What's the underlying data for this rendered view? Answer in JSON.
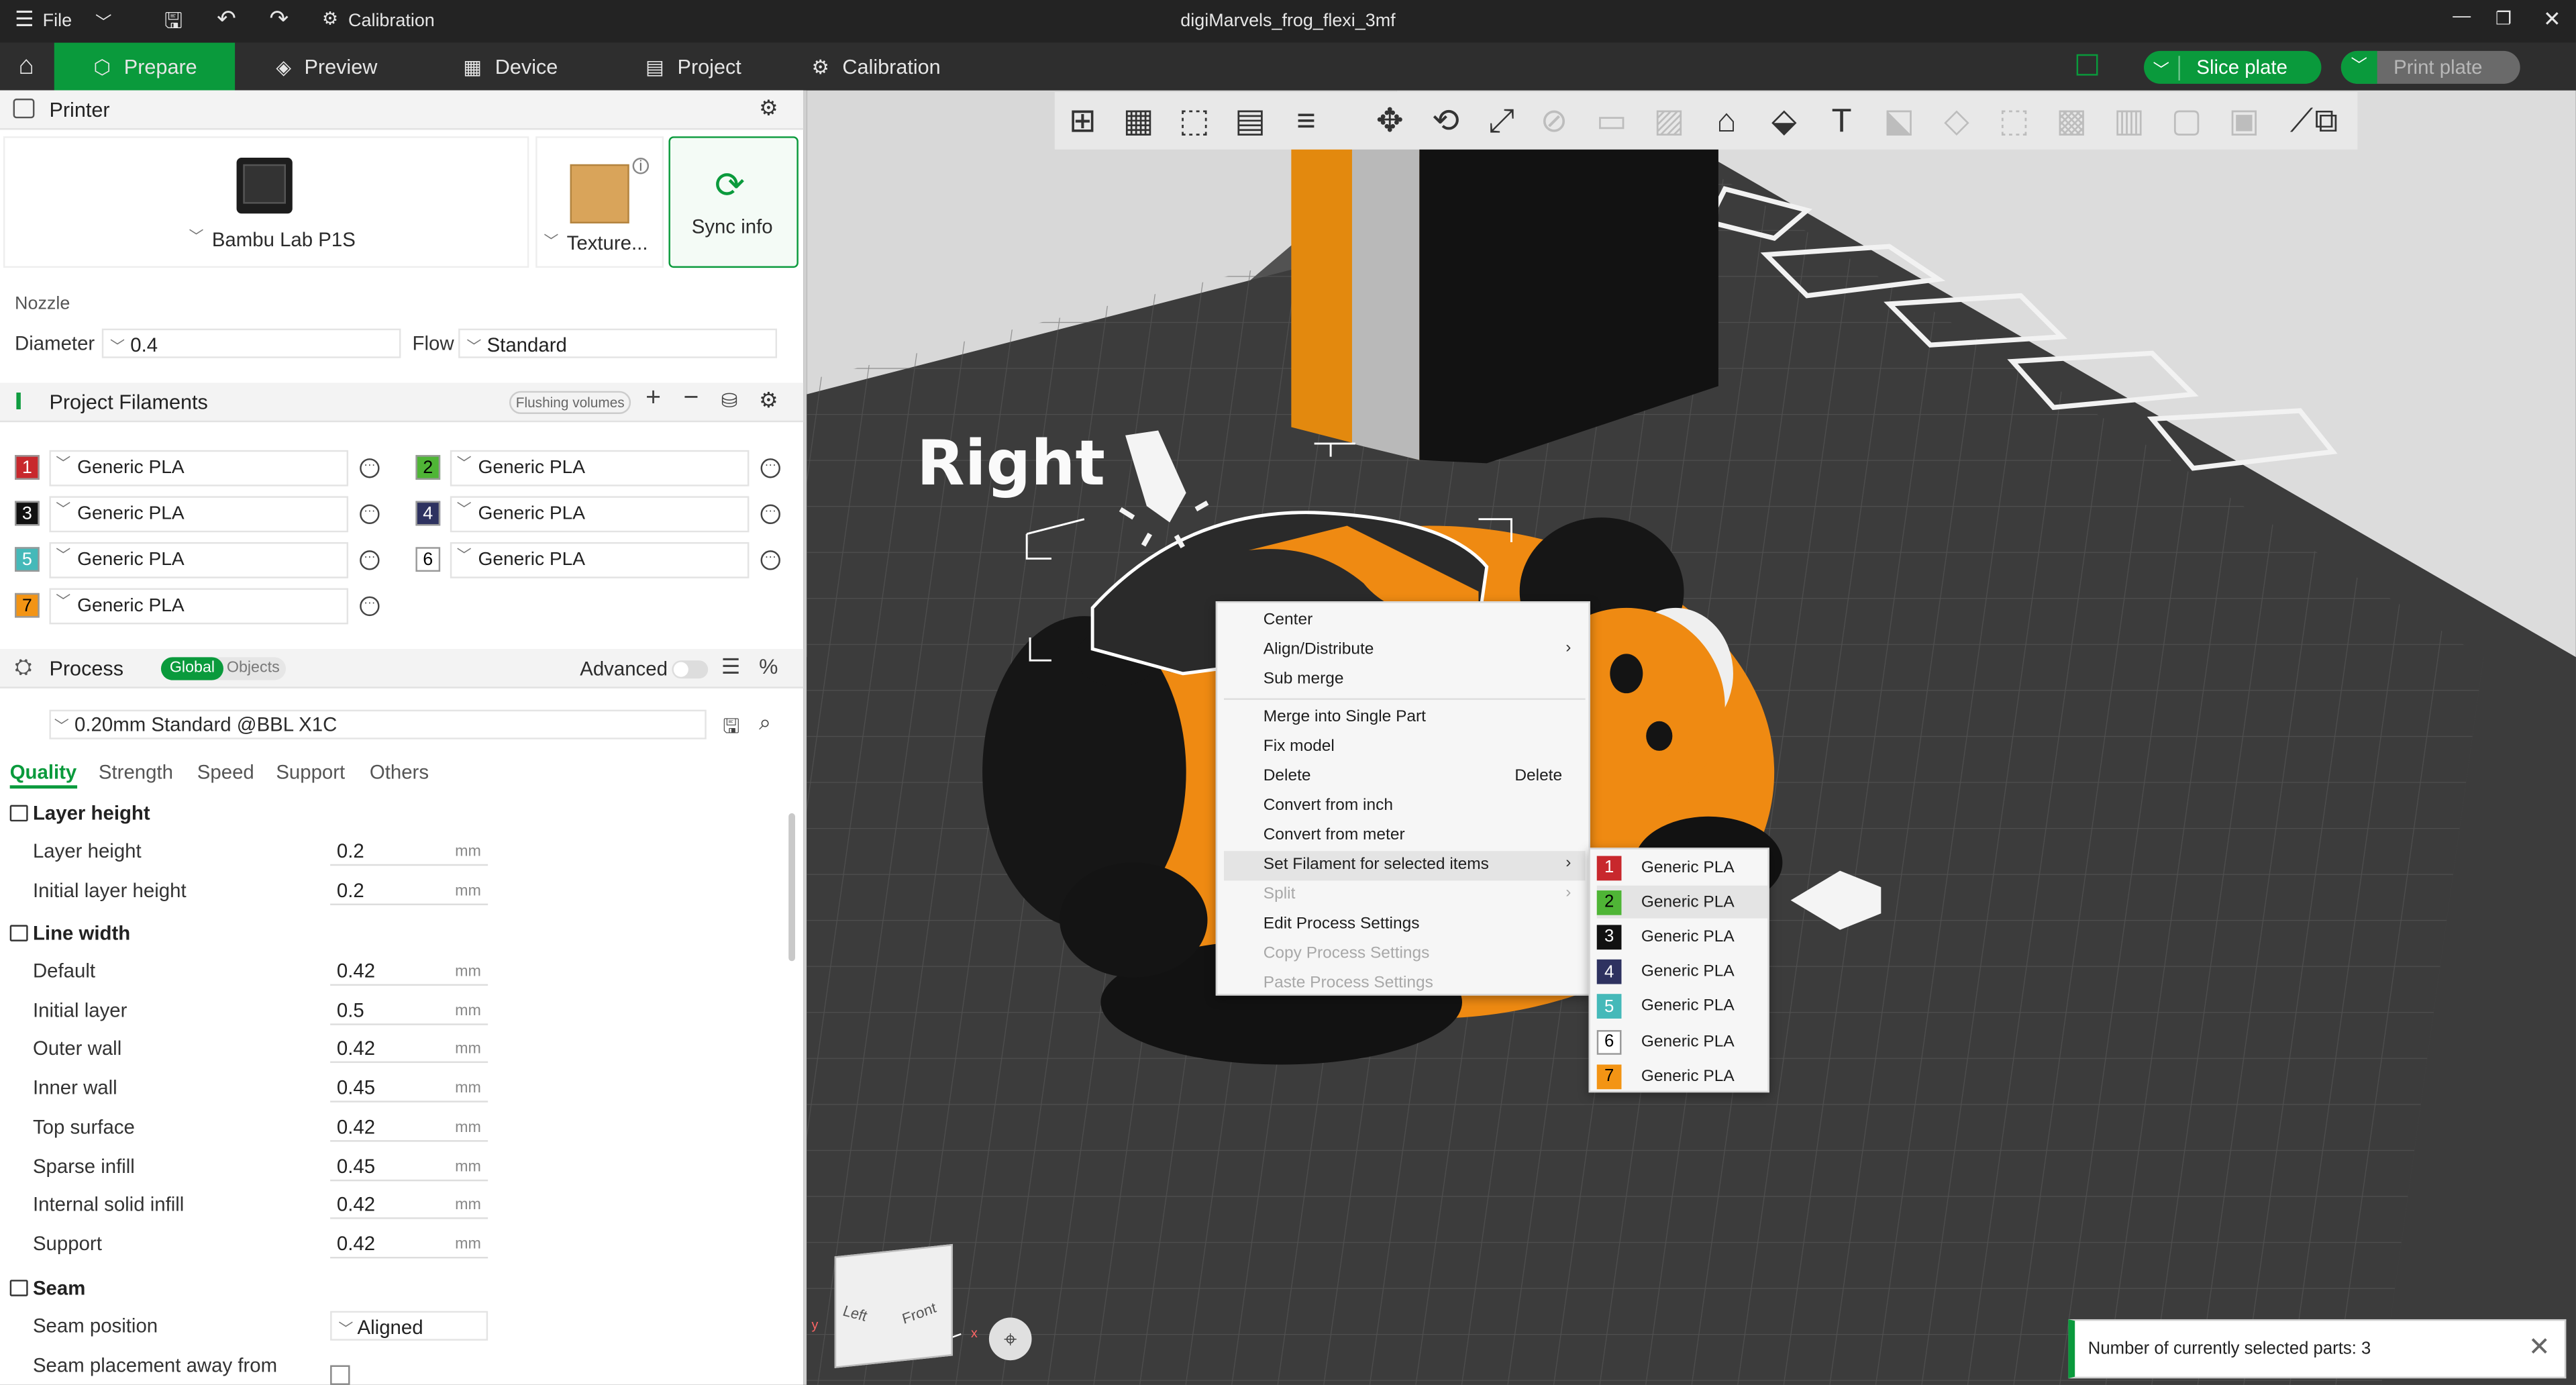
{
  "titlebar": {
    "file_label": "File",
    "calibration_label": "Calibration",
    "document_title": "digiMarvels_frog_flexi_3mf"
  },
  "tabs": [
    {
      "label": "Prepare"
    },
    {
      "label": "Preview"
    },
    {
      "label": "Device"
    },
    {
      "label": "Project"
    },
    {
      "label": "Calibration"
    }
  ],
  "actions": {
    "slice_label": "Slice plate",
    "print_label": "Print plate"
  },
  "printer": {
    "section_title": "Printer",
    "printer_name": "Bambu Lab P1S",
    "plate_name": "Texture...",
    "sync_label": "Sync info"
  },
  "nozzle": {
    "title": "Nozzle",
    "diameter_label": "Diameter",
    "diameter_value": "0.4",
    "flow_label": "Flow",
    "flow_value": "Standard"
  },
  "filaments": {
    "section_title": "Project Filaments",
    "flushing_label": "Flushing volumes",
    "items": [
      {
        "num": "1",
        "name": "Generic PLA",
        "color": "#c8282d",
        "text_color": "#ffffff"
      },
      {
        "num": "2",
        "name": "Generic PLA",
        "color": "#4fb536",
        "text_color": "#000000"
      },
      {
        "num": "3",
        "name": "Generic PLA",
        "color": "#111111",
        "text_color": "#ffffff"
      },
      {
        "num": "4",
        "name": "Generic PLA",
        "color": "#2e3260",
        "text_color": "#ffffff"
      },
      {
        "num": "5",
        "name": "Generic PLA",
        "color": "#45b9b9",
        "text_color": "#ffffff"
      },
      {
        "num": "6",
        "name": "Generic PLA",
        "color": "#ffffff",
        "text_color": "#000000"
      },
      {
        "num": "7",
        "name": "Generic PLA",
        "color": "#f39414",
        "text_color": "#000000"
      }
    ]
  },
  "process": {
    "section_title": "Process",
    "global_label": "Global",
    "objects_label": "Objects",
    "advanced_label": "Advanced",
    "preset": "0.20mm Standard @BBL X1C",
    "tabs": [
      "Quality",
      "Strength",
      "Speed",
      "Support",
      "Others"
    ],
    "layer_height": {
      "title": "Layer height",
      "rows": [
        {
          "label": "Layer height",
          "value": "0.2",
          "unit": "mm"
        },
        {
          "label": "Initial layer height",
          "value": "0.2",
          "unit": "mm"
        }
      ]
    },
    "line_width": {
      "title": "Line width",
      "rows": [
        {
          "label": "Default",
          "value": "0.42",
          "unit": "mm"
        },
        {
          "label": "Initial layer",
          "value": "0.5",
          "unit": "mm"
        },
        {
          "label": "Outer wall",
          "value": "0.42",
          "unit": "mm"
        },
        {
          "label": "Inner wall",
          "value": "0.45",
          "unit": "mm"
        },
        {
          "label": "Top surface",
          "value": "0.42",
          "unit": "mm"
        },
        {
          "label": "Sparse infill",
          "value": "0.45",
          "unit": "mm"
        },
        {
          "label": "Internal solid infill",
          "value": "0.42",
          "unit": "mm"
        },
        {
          "label": "Support",
          "value": "0.42",
          "unit": "mm"
        }
      ]
    },
    "seam": {
      "title": "Seam",
      "position_label": "Seam position",
      "position_value": "Aligned",
      "away_label": "Seam placement away from"
    }
  },
  "annotation": {
    "text": "Right"
  },
  "cube": {
    "left": "Left",
    "front": "Front"
  },
  "context_menu": {
    "items": [
      {
        "label": "Center"
      },
      {
        "label": "Align/Distribute"
      },
      {
        "label": "Sub merge"
      },
      {
        "label": "Merge into Single Part"
      },
      {
        "label": "Fix model"
      },
      {
        "label": "Delete",
        "shortcut": "Delete"
      },
      {
        "label": "Convert from inch"
      },
      {
        "label": "Convert from meter"
      },
      {
        "label": "Set Filament for selected items"
      },
      {
        "label": "Split"
      },
      {
        "label": "Edit Process Settings"
      },
      {
        "label": "Copy Process Settings"
      },
      {
        "label": "Paste Process Settings"
      }
    ]
  },
  "submenu": {
    "items": [
      "Generic PLA",
      "Generic PLA",
      "Generic PLA",
      "Generic PLA",
      "Generic PLA",
      "Generic PLA",
      "Generic PLA"
    ]
  },
  "notification": {
    "text": "Number of currently selected parts: 3"
  }
}
